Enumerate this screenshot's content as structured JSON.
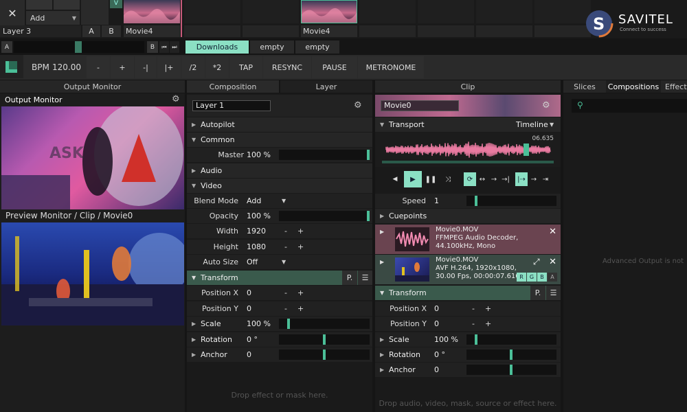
{
  "clip_grid": {
    "close_icon": "✕",
    "add_label": "Add",
    "layer_name": "Layer 3",
    "a_label": "A",
    "b_label": "B",
    "v_label": "V",
    "clip1_name": "Movie4",
    "clip2_name": "Movie4"
  },
  "deck": {
    "a_label": "A",
    "b_label": "B",
    "tabs": [
      "Downloads",
      "empty",
      "empty"
    ]
  },
  "transport_bar": {
    "bpm_label": "BPM",
    "bpm_value": "120.00",
    "buttons": [
      "-",
      "+",
      "-|",
      "|+",
      "/2",
      "*2",
      "TAP",
      "RESYNC",
      "PAUSE",
      "METRONOME"
    ]
  },
  "logo": {
    "name": "SAVITEL",
    "tagline": "Connect to success"
  },
  "output_monitor": {
    "header": "Output Monitor",
    "title": "Output Monitor",
    "preview_label": "Preview Monitor / Clip / Movie0"
  },
  "composition": {
    "tab_composition": "Composition",
    "tab_layer": "Layer",
    "layer_name": "Layer 1",
    "sections": {
      "autopilot": "Autopilot",
      "common": "Common",
      "audio": "Audio",
      "video": "Video",
      "transform": "Transform"
    },
    "master_label": "Master",
    "master_value": "100 %",
    "master_level": 1.0,
    "blend_label": "Blend Mode",
    "blend_value": "Add",
    "opacity_label": "Opacity",
    "opacity_value": "100 %",
    "opacity_level": 1.0,
    "width_label": "Width",
    "width_value": "1920",
    "height_label": "Height",
    "height_value": "1080",
    "autosize_label": "Auto Size",
    "autosize_value": "Off",
    "transform_p": "P.",
    "posx_label": "Position X",
    "posx_value": "0",
    "posy_label": "Position Y",
    "posy_value": "0",
    "scale_label": "Scale",
    "scale_value": "100 %",
    "rotation_label": "Rotation",
    "rotation_value": "0 °",
    "anchor_label": "Anchor",
    "anchor_value": "0",
    "drop_text": "Drop effect or mask here.",
    "minus": "-",
    "plus": "+"
  },
  "clip": {
    "header": "Clip",
    "name": "Movie0",
    "transport_label": "Transport",
    "timeline_label": "Timeline",
    "time_value": "06.635",
    "speed_label": "Speed",
    "speed_value": "1",
    "cuepoints_label": "Cuepoints",
    "audio_file": "Movie0.MOV",
    "audio_line2": "FFMPEG Audio Decoder,",
    "audio_line3": "44.100kHz, Mono",
    "video_file": "Movie0.MOV",
    "video_line2": "AVF H.264, 1920x1080,",
    "video_line3": "30.00 Fps, 00:00:07.616",
    "rgba": [
      "R",
      "G",
      "B",
      "A"
    ],
    "transform_label": "Transform",
    "transform_p": "P.",
    "posx_label": "Position X",
    "posx_value": "0",
    "posy_label": "Position Y",
    "posy_value": "0",
    "scale_label": "Scale",
    "scale_value": "100 %",
    "rotation_label": "Rotation",
    "rotation_value": "0 °",
    "anchor_label": "Anchor",
    "anchor_value": "0",
    "drop_text": "Drop audio, video, mask, source or effect here.",
    "minus": "-",
    "plus": "+"
  },
  "browser": {
    "tabs": [
      "Slices",
      "Compositions",
      "Effects"
    ],
    "advanced_output_text": "Advanced Output is not"
  },
  "colors": {
    "accent": "#4bbf98",
    "tab_active": "#8be0c4",
    "waveform": "#e87aa0",
    "audio_row": "#6a4450"
  }
}
